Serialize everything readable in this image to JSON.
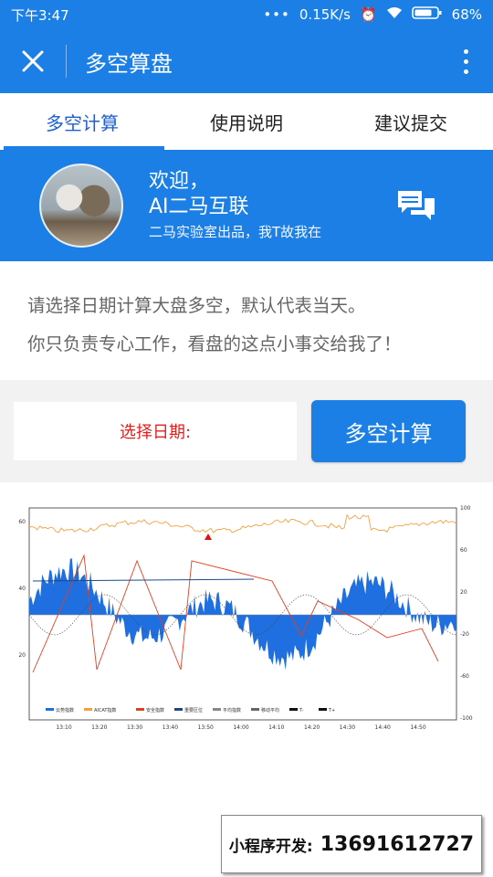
{
  "status": {
    "time": "下午3:47",
    "speed": "0.15K/s",
    "battery": "68%"
  },
  "appbar": {
    "title": "多空算盘",
    "close_icon": "close-icon",
    "more_icon": "more-vertical-icon"
  },
  "tabs": [
    {
      "label": "多空计算",
      "active": true
    },
    {
      "label": "使用说明",
      "active": false
    },
    {
      "label": "建议提交",
      "active": false
    }
  ],
  "banner": {
    "welcome_line1": "欢迎，",
    "welcome_line2": "AI二马互联",
    "subtitle": "二马实验室出品，我T故我在",
    "chat_icon": "chat-bubbles-icon"
  },
  "intro": {
    "line1": "请选择日期计算大盘多空，默认代表当天。",
    "line2": "你只负责专心工作，看盘的这点小事交给我了！"
  },
  "form": {
    "date_label": "选择日期:",
    "calc_button": "多空计算"
  },
  "chart_data": {
    "type": "line",
    "x_ticks": [
      "13:10",
      "13:20",
      "13:30",
      "13:40",
      "13:50",
      "14:00",
      "14:10",
      "14:20",
      "14:30",
      "14:40",
      "14:50"
    ],
    "y_left_ticks": [
      "60",
      "40",
      "20"
    ],
    "y_right_ticks": [
      "100",
      "60",
      "20",
      "-20",
      "-60",
      "-100"
    ],
    "legend": [
      "云势指数",
      "AICAT指数",
      "安全指数",
      "重要区位",
      "平均指数",
      "移动平均",
      "T-",
      "T+"
    ],
    "colors": {
      "bars": "#1f6fe0",
      "orange": "#f5a040",
      "red": "#e04020",
      "navy": "#1a4a8a"
    }
  },
  "contact": {
    "label": "小程序开发:",
    "phone": "13691612727"
  }
}
